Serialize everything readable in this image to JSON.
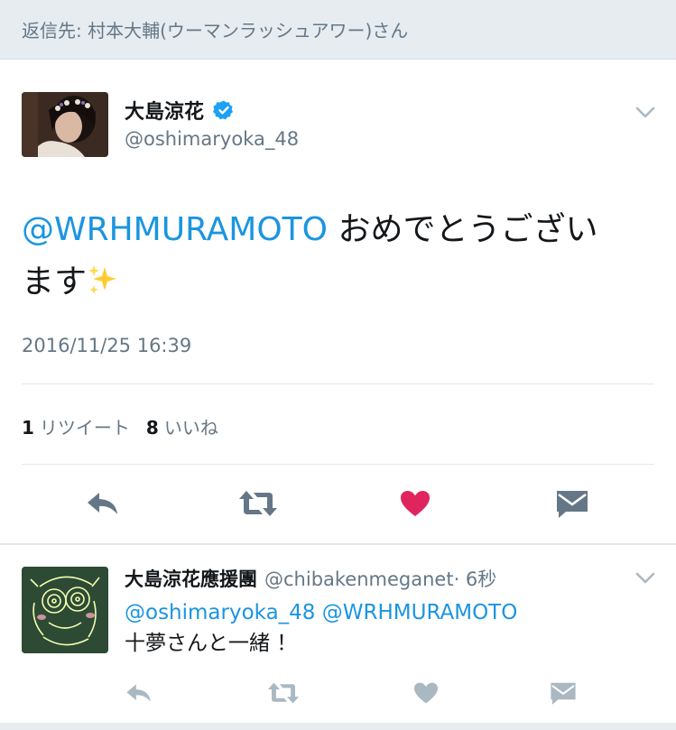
{
  "reply_context": {
    "text": "返信先: 村本大輔(ウーマンラッシュアワー)さん"
  },
  "main_tweet": {
    "display_name": "大島涼花",
    "handle": "@oshimaryoka_48",
    "verified": true,
    "mention": "@WRHMURAMOTO",
    "text_line1": " おめでとうござい",
    "text_line2": "ます",
    "emoji": "sparkles-emoji",
    "timestamp": "2016/11/25 16:39",
    "retweet_count": "1",
    "retweet_label": "リツイート",
    "like_count": "8",
    "like_label": "いいね",
    "liked": true
  },
  "reply_tweet": {
    "display_name": "大島涼花應援團",
    "handle": "@chibakenmeganet",
    "time": " · 6秒",
    "mention1": "@oshimaryoka_48",
    "mention2": "@WRHMURAMOTO",
    "text": "十夢さんと一緒 ！"
  },
  "colors": {
    "accent_blue": "#1b95e0",
    "like_red": "#e0245e",
    "icon_grey": "#657786",
    "icon_light": "#aab8c2",
    "verified_blue": "#1da1f2"
  }
}
